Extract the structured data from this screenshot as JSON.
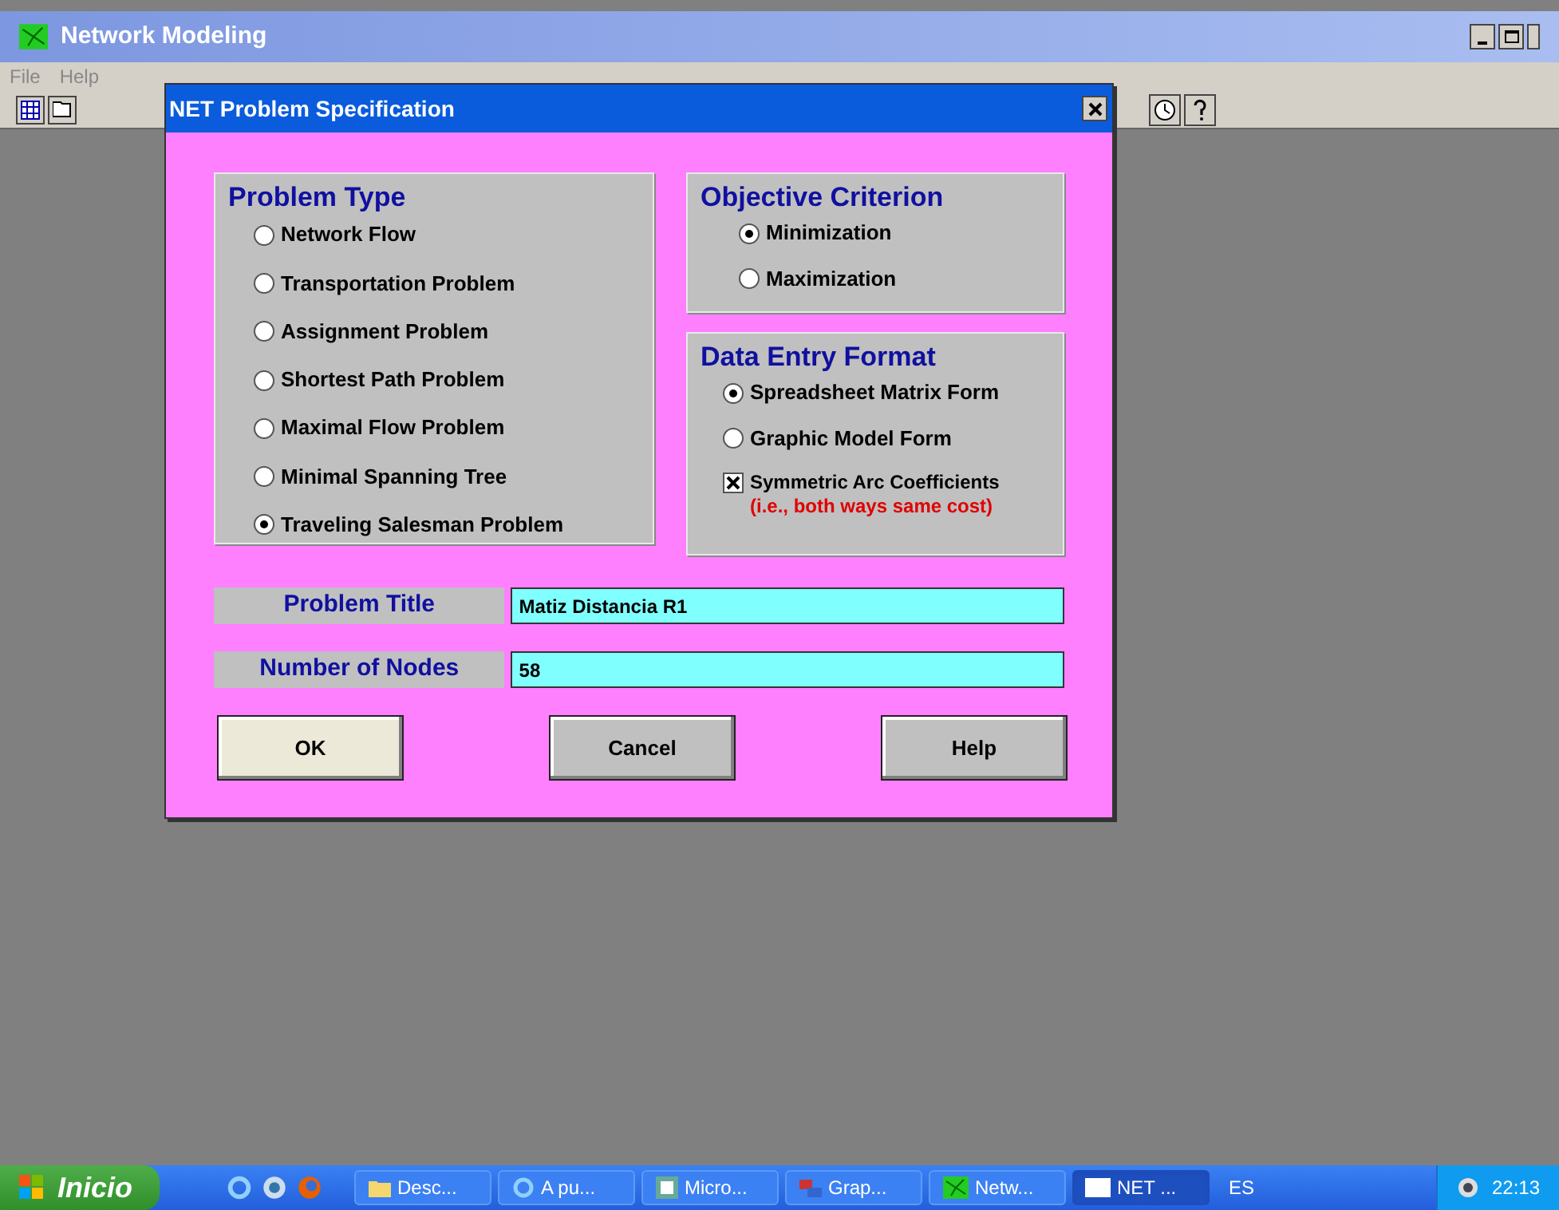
{
  "window": {
    "title": "Network Modeling"
  },
  "menu": [
    "File",
    "Help"
  ],
  "dialog": {
    "title": "NET Problem Specification",
    "problem_type": {
      "label": "Problem Type",
      "options": [
        {
          "label": "Network Flow",
          "selected": false
        },
        {
          "label": "Transportation Problem",
          "selected": false
        },
        {
          "label": "Assignment Problem",
          "selected": false
        },
        {
          "label": "Shortest Path Problem",
          "selected": false
        },
        {
          "label": "Maximal Flow Problem",
          "selected": false
        },
        {
          "label": "Minimal Spanning Tree",
          "selected": false
        },
        {
          "label": "Traveling Salesman Problem",
          "selected": true
        }
      ]
    },
    "objective": {
      "label": "Objective Criterion",
      "options": [
        {
          "label": "Minimization",
          "selected": true
        },
        {
          "label": "Maximization",
          "selected": false
        }
      ]
    },
    "data_entry": {
      "label": "Data Entry Format",
      "options": [
        {
          "label": "Spreadsheet Matrix Form",
          "selected": true
        },
        {
          "label": "Graphic Model Form",
          "selected": false
        }
      ],
      "symmetric": {
        "label": "Symmetric Arc Coefficients",
        "note": "(i.e., both ways same cost)",
        "checked": true
      }
    },
    "fields": [
      {
        "label": "Problem Title",
        "value": "Matiz Distancia R1"
      },
      {
        "label": "Number of Nodes",
        "value": "58"
      }
    ],
    "buttons": [
      "OK",
      "Cancel",
      "Help"
    ]
  },
  "taskbar": {
    "start": "Inicio",
    "tasks": [
      {
        "label": "Desc...",
        "kind": "folder",
        "selected": false
      },
      {
        "label": "A pu...",
        "kind": "browser",
        "selected": false
      },
      {
        "label": "Micro...",
        "kind": "app",
        "selected": false
      },
      {
        "label": "Grap...",
        "kind": "graph",
        "selected": false
      },
      {
        "label": "Netw...",
        "kind": "network",
        "selected": false
      },
      {
        "label": "NET ...",
        "kind": "window",
        "selected": true
      }
    ],
    "language": "ES",
    "clock": "22:13"
  }
}
